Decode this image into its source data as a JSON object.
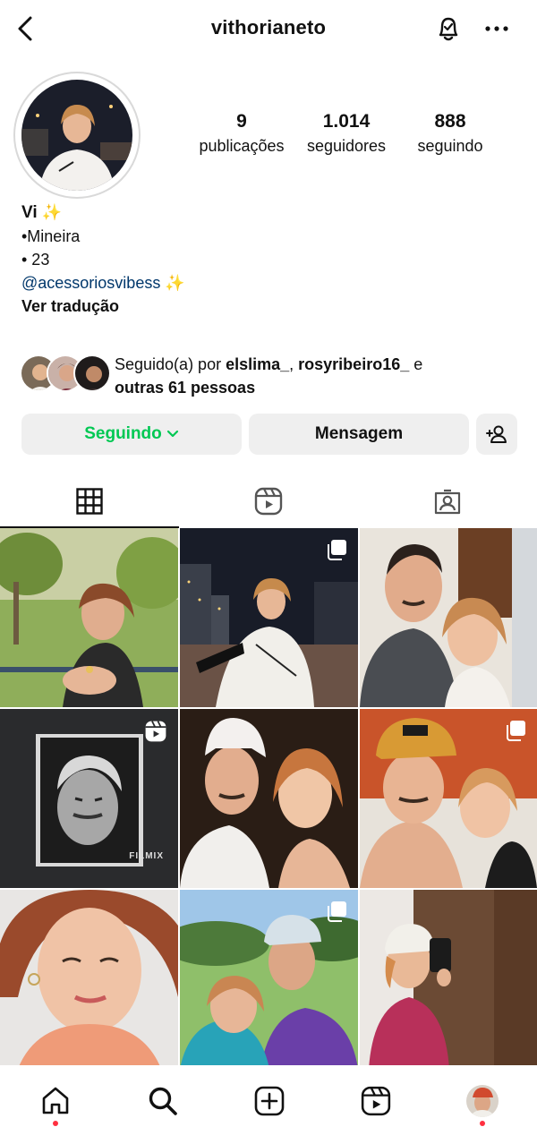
{
  "header": {
    "username": "vithorianeto",
    "icons": [
      "back-arrow-icon",
      "bell-check-icon",
      "more-dots-icon"
    ]
  },
  "profile": {
    "stats": [
      {
        "value": "9",
        "label": "publicações"
      },
      {
        "value": "1.014",
        "label": "seguidores"
      },
      {
        "value": "888",
        "label": "seguindo"
      }
    ],
    "bio": {
      "name": "Vi",
      "name_emoji": "✨",
      "line1": "•Mineira",
      "line2": "• 23",
      "link": "@acessoriosvibess",
      "link_emoji": "✨",
      "translate": "Ver tradução"
    },
    "followed_by": {
      "prefix": "Seguido(a) por ",
      "user1": "elslima_",
      "sep": ", ",
      "user2": "rosyribeiro16_",
      "conj": " e",
      "others": "outras 61 pessoas"
    }
  },
  "actions": {
    "following_label": "Seguindo",
    "message_label": "Mensagem"
  },
  "tabs": [
    "grid-icon",
    "reels-icon",
    "tagged-icon"
  ],
  "grid": {
    "tiles": [
      {
        "badge": ""
      },
      {
        "badge": "carousel"
      },
      {
        "badge": ""
      },
      {
        "badge": "reel",
        "watermark": "FILMIX"
      },
      {
        "badge": ""
      },
      {
        "badge": "carousel"
      },
      {
        "badge": ""
      },
      {
        "badge": "carousel"
      },
      {
        "badge": ""
      }
    ]
  },
  "bottom_nav": [
    "home-icon",
    "search-icon",
    "create-icon",
    "reels-icon",
    "profile-avatar"
  ],
  "colors": {
    "following_green": "#00c853",
    "link_blue": "#00376b",
    "button_bg": "#efefef",
    "notification_dot": "#ff3040"
  }
}
